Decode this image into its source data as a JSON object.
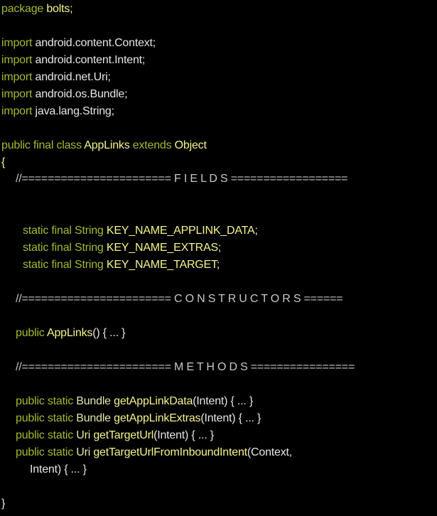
{
  "code": {
    "package_kw": "package",
    "package_name": "bolts;",
    "import_kw": "import",
    "imports": [
      "android.content.Context;",
      "android.content.Intent;",
      "android.net.Uri;",
      "android.os.Bundle;",
      "java.lang.String;"
    ],
    "class_decl": {
      "modifiers": "public final class",
      "name": "AppLinks",
      "extends_kw": "extends",
      "parent": "Object"
    },
    "open_brace": "{",
    "close_brace": "}",
    "fields_comment": "//======================= F I E L D S ==================",
    "fields": [
      {
        "modifiers": "static final",
        "type": "String",
        "name": "KEY_NAME_APPLINK_DATA",
        "end": ";"
      },
      {
        "modifiers": "static final",
        "type": "String",
        "name": "KEY_NAME_EXTRAS",
        "end": ";"
      },
      {
        "modifiers": "static final",
        "type": "String",
        "name": "KEY_NAME_TARGET",
        "end": ";"
      }
    ],
    "constructors_comment": "//======================= C O N S T R U C T O R S ======",
    "constructor": {
      "modifier": "public",
      "name": "AppLinks",
      "rest": "() { ... }"
    },
    "methods_comment": "//======================= M E T H O D S ================",
    "methods": [
      {
        "modifiers": "public static",
        "type": "Bundle",
        "name": "getAppLinkData",
        "rest": "(Intent) { ... }"
      },
      {
        "modifiers": "public static",
        "type": "Bundle",
        "name": "getAppLinkExtras",
        "rest": "(Intent) { ... }"
      },
      {
        "modifiers": "public static",
        "type": "Uri",
        "name": "getTargetUrl",
        "rest": "(Intent) { ... }"
      },
      {
        "modifiers": "public static",
        "type": "Uri",
        "name": "getTargetUrlFromInboundIntent",
        "rest": "(Context,"
      }
    ],
    "method_continuation": "Intent) { ... }"
  }
}
